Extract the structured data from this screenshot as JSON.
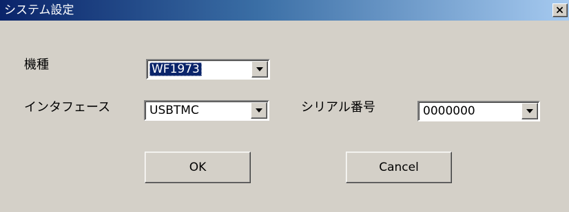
{
  "window": {
    "title": "システム設定",
    "colors": {
      "title_bar_start": "#0a246a",
      "title_bar_end": "#a6caf0",
      "dialog_background": "#d4d0c8"
    }
  },
  "form": {
    "model": {
      "label": "機種",
      "value": "WF1973"
    },
    "interface": {
      "label": "インタフェース",
      "value": "USBTMC"
    },
    "serial": {
      "label": "シリアル番号",
      "value": "0000000"
    }
  },
  "buttons": {
    "ok_label": "OK",
    "cancel_label": "Cancel"
  },
  "icons": {
    "close": "close-icon",
    "dropdown": "chevron-down-icon"
  }
}
